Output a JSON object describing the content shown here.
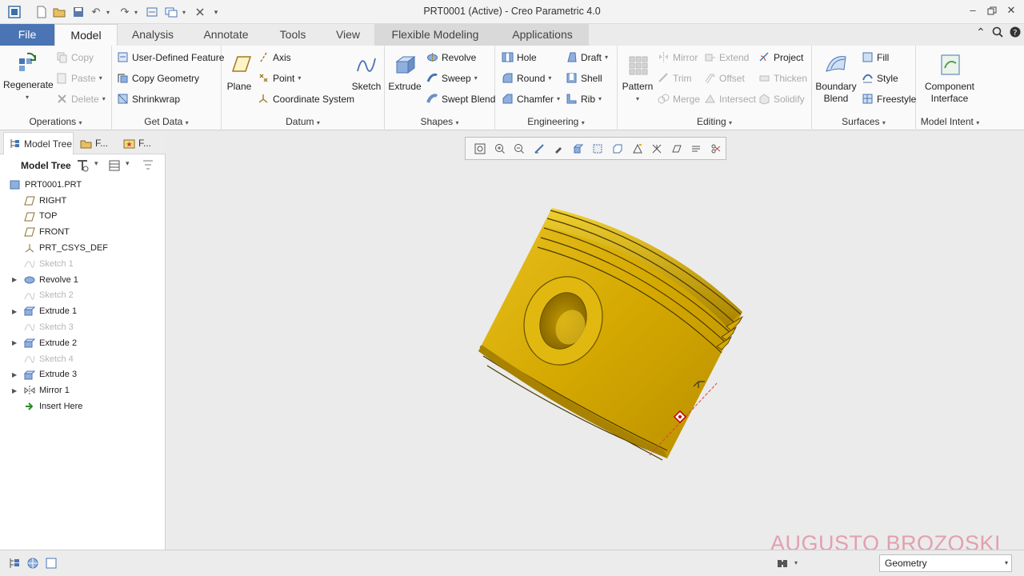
{
  "window": {
    "title": "PRT0001 (Active) - Creo Parametric 4.0"
  },
  "tabs": [
    {
      "label": "File"
    },
    {
      "label": "Model"
    },
    {
      "label": "Analysis"
    },
    {
      "label": "Annotate"
    },
    {
      "label": "Tools"
    },
    {
      "label": "View"
    },
    {
      "label": "Flexible Modeling"
    },
    {
      "label": "Applications"
    }
  ],
  "ribbon": {
    "operations": {
      "label": "Operations",
      "regenerate": "Regenerate",
      "copy": "Copy",
      "paste": "Paste",
      "delete": "Delete"
    },
    "get_data": {
      "label": "Get Data",
      "udf": "User-Defined Feature",
      "copy_geometry": "Copy Geometry",
      "shrinkwrap": "Shrinkwrap"
    },
    "datum": {
      "label": "Datum",
      "plane": "Plane",
      "axis": "Axis",
      "point": "Point",
      "csys": "Coordinate System",
      "sketch": "Sketch"
    },
    "shapes": {
      "label": "Shapes",
      "extrude": "Extrude",
      "revolve": "Revolve",
      "sweep": "Sweep",
      "swept_blend": "Swept Blend"
    },
    "engineering": {
      "label": "Engineering",
      "hole": "Hole",
      "round": "Round",
      "chamfer": "Chamfer",
      "draft": "Draft",
      "shell": "Shell",
      "rib": "Rib"
    },
    "editing": {
      "label": "Editing",
      "pattern": "Pattern",
      "mirror": "Mirror",
      "trim": "Trim",
      "merge": "Merge",
      "extend": "Extend",
      "offset": "Offset",
      "intersect": "Intersect",
      "project": "Project",
      "thicken": "Thicken",
      "solidify": "Solidify"
    },
    "surfaces": {
      "label": "Surfaces",
      "boundary_line1": "Boundary",
      "boundary_line2": "Blend",
      "fill": "Fill",
      "style": "Style",
      "freestyle": "Freestyle"
    },
    "model_intent": {
      "label": "Model Intent",
      "ci_line1": "Component",
      "ci_line2": "Interface"
    }
  },
  "panel": {
    "tab_model_tree": "Model Tree",
    "tab_folder": "F...",
    "tab_favorites": "F...",
    "toolbar_label": "Model Tree"
  },
  "tree": [
    {
      "label": "PRT0001.PRT",
      "icon": "part-icon",
      "suppressed": false,
      "expandable": false,
      "indent": 0
    },
    {
      "label": "RIGHT",
      "icon": "datum-plane-icon",
      "suppressed": false,
      "expandable": false,
      "indent": 1
    },
    {
      "label": "TOP",
      "icon": "datum-plane-icon",
      "suppressed": false,
      "expandable": false,
      "indent": 1
    },
    {
      "label": "FRONT",
      "icon": "datum-plane-icon",
      "suppressed": false,
      "expandable": false,
      "indent": 1
    },
    {
      "label": "PRT_CSYS_DEF",
      "icon": "csys-icon",
      "suppressed": false,
      "expandable": false,
      "indent": 1
    },
    {
      "label": "Sketch 1",
      "icon": "sketch-icon",
      "suppressed": true,
      "expandable": false,
      "indent": 1
    },
    {
      "label": "Revolve 1",
      "icon": "revolve-icon",
      "suppressed": false,
      "expandable": true,
      "indent": 1
    },
    {
      "label": "Sketch 2",
      "icon": "sketch-icon",
      "suppressed": true,
      "expandable": false,
      "indent": 1
    },
    {
      "label": "Extrude 1",
      "icon": "extrude-icon",
      "suppressed": false,
      "expandable": true,
      "indent": 1
    },
    {
      "label": "Sketch 3",
      "icon": "sketch-icon",
      "suppressed": true,
      "expandable": false,
      "indent": 1
    },
    {
      "label": "Extrude 2",
      "icon": "extrude-icon",
      "suppressed": false,
      "expandable": true,
      "indent": 1
    },
    {
      "label": "Sketch 4",
      "icon": "sketch-icon",
      "suppressed": true,
      "expandable": false,
      "indent": 1
    },
    {
      "label": "Extrude 3",
      "icon": "extrude-icon",
      "suppressed": false,
      "expandable": true,
      "indent": 1
    },
    {
      "label": "Mirror 1",
      "icon": "mirror-icon",
      "suppressed": false,
      "expandable": true,
      "indent": 1
    },
    {
      "label": "Insert Here",
      "icon": "insert-here-icon",
      "suppressed": false,
      "expandable": false,
      "indent": 1
    }
  ],
  "graphics_toolbar": [
    "refit-icon",
    "zoom-in-icon",
    "zoom-out-icon",
    "repaint-icon",
    "pan-icon",
    "display-style-icon",
    "saved-orientations-icon",
    "view-manager-icon",
    "perspective-icon",
    "datum-display-icon",
    "spin-center-icon",
    "annotation-display-icon",
    "appearance-icon"
  ],
  "watermark": "AUGUSTO BROZOSKI",
  "status": {
    "filter_value": "Geometry"
  },
  "colors": {
    "file_tab": "#4a74b4",
    "model_gold": "#d9b000",
    "watermark": "#e2a0b0"
  }
}
